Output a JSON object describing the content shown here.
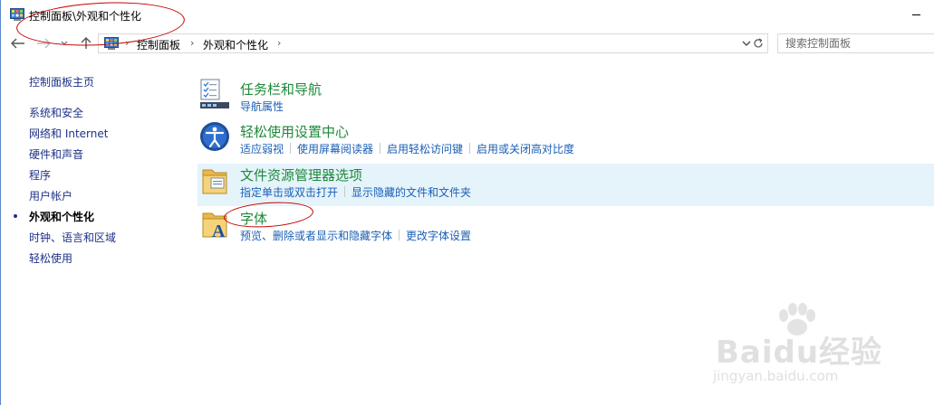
{
  "window": {
    "title": "控制面板\\外观和个性化"
  },
  "address": {
    "crumbs": [
      "控制面板",
      "外观和个性化"
    ],
    "search_placeholder": "搜索控制面板"
  },
  "sidebar": {
    "items": [
      {
        "label": "控制面板主页",
        "active": false
      },
      {
        "label": "系统和安全",
        "active": false
      },
      {
        "label": "网络和 Internet",
        "active": false
      },
      {
        "label": "硬件和声音",
        "active": false
      },
      {
        "label": "程序",
        "active": false
      },
      {
        "label": "用户帐户",
        "active": false
      },
      {
        "label": "外观和个性化",
        "active": true
      },
      {
        "label": "时钟、语言和区域",
        "active": false
      },
      {
        "label": "轻松使用",
        "active": false
      }
    ]
  },
  "categories": [
    {
      "title": "任务栏和导航",
      "icon": "taskbar-icon",
      "links": [
        "导航属性"
      ]
    },
    {
      "title": "轻松使用设置中心",
      "icon": "ease-of-access-icon",
      "links": [
        "适应弱视",
        "使用屏幕阅读器",
        "启用轻松访问键",
        "启用或关闭高对比度"
      ]
    },
    {
      "title": "文件资源管理器选项",
      "icon": "folder-options-icon",
      "links": [
        "指定单击或双击打开",
        "显示隐藏的文件和文件夹"
      ]
    },
    {
      "title": "字体",
      "icon": "fonts-folder-icon",
      "links": [
        "预览、删除或者显示和隐藏字体",
        "更改字体设置"
      ]
    }
  ],
  "watermark": {
    "brand": "Baidu经验",
    "url": "jingyan.baidu.com"
  },
  "colors": {
    "link": "#1a5fb4",
    "category_title": "#1e8a3a",
    "highlight": "#e5f3fb",
    "annotation": "#c40000"
  }
}
